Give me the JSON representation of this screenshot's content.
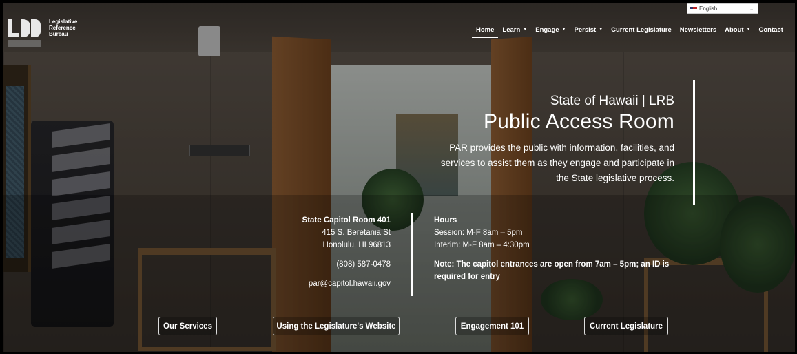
{
  "logo": {
    "line1": "Legislative",
    "line2": "Reference",
    "line3": "Bureau"
  },
  "language": {
    "selected": "English"
  },
  "nav": [
    {
      "label": "Home",
      "dropdown": false,
      "active": true
    },
    {
      "label": "Learn",
      "dropdown": true
    },
    {
      "label": "Engage",
      "dropdown": true
    },
    {
      "label": "Persist",
      "dropdown": true
    },
    {
      "label": "Current Legislature",
      "dropdown": false
    },
    {
      "label": "Newsletters",
      "dropdown": false
    },
    {
      "label": "About",
      "dropdown": true
    },
    {
      "label": "Contact",
      "dropdown": false
    }
  ],
  "hero": {
    "subtitle": "State of Hawaii | LRB",
    "title": "Public Access Room",
    "desc_line1": "PAR provides the public with information, facilities, and",
    "desc_line2": "services to assist them as they engage and participate in",
    "desc_line3": "the State legislative process."
  },
  "location": {
    "room": "State Capitol Room 401",
    "street": "415 S. Beretania St",
    "city": "Honolulu, HI 96813",
    "phone": "(808) 587-0478",
    "email": "par@capitol.hawaii.gov"
  },
  "hours": {
    "heading": "Hours",
    "session": "Session: M-F 8am – 5pm",
    "interim": "Interim: M-F 8am – 4:30pm",
    "note_line1": "Note: The capitol entrances are open from 7am – 5pm; an ID is",
    "note_line2": "required for entry"
  },
  "buttons": {
    "services": "Our Services",
    "website": "Using the Legislature's Website",
    "engagement": "Engagement 101",
    "current": "Current Legislature"
  },
  "colors": {
    "overlay": "#000000",
    "text": "#ffffff"
  }
}
